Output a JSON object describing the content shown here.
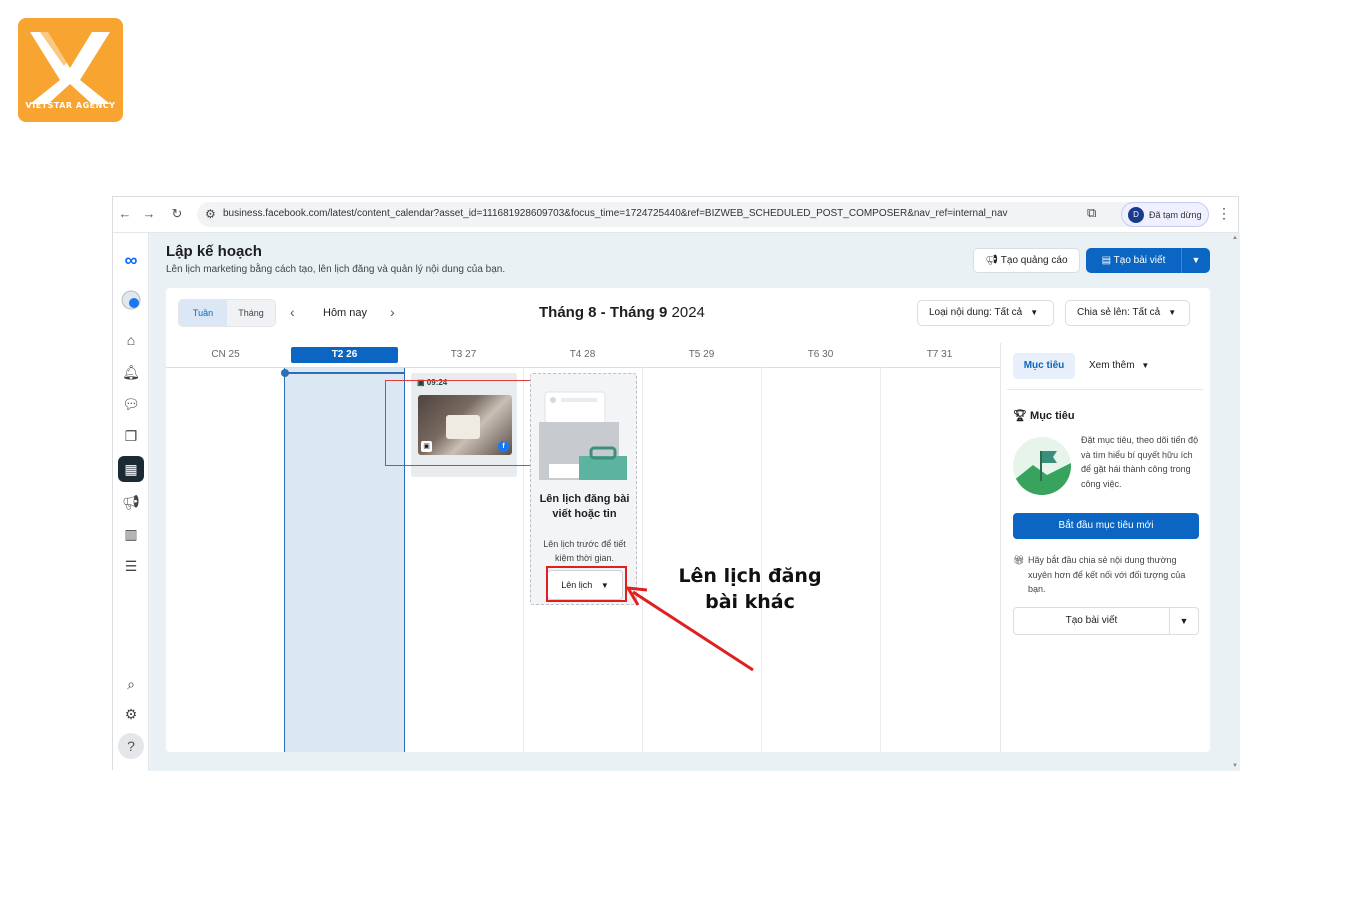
{
  "brand": {
    "logo_text": "VIETSTAR AGENCY",
    "accent": "#f7a530"
  },
  "browser": {
    "url": "business.facebook.com/latest/content_calendar?asset_id=111681928609703&focus_time=1724725440&ref=BIZWEB_SCHEDULED_POST_COMPOSER&nav_ref=internal_nav",
    "profile_initial": "D",
    "profile_label": "Đã tạm dừng"
  },
  "header": {
    "title": "Lập kế hoạch",
    "subtitle": "Lên lịch marketing bằng cách tạo, lên lịch đăng và quản lý nội dung của bạn.",
    "create_ad": "Tạo quảng cáo",
    "create_post": "Tạo bài viết"
  },
  "calendar": {
    "view_week": "Tuần",
    "view_month": "Tháng",
    "today": "Hôm nay",
    "range_bold": "Tháng 8 - Tháng 9",
    "range_year": "2024",
    "content_filter": "Loại nội dung: Tất cả",
    "share_filter": "Chia sẻ lên: Tất cả",
    "days": [
      "CN 25",
      "T2 26",
      "T3 27",
      "T4 28",
      "T5 29",
      "T6 30",
      "T7 31"
    ],
    "selected_day_index": 1,
    "post_time": "09:24",
    "empty_title": "Lên lịch đăng bài viết hoặc tin",
    "empty_sub": "Lên lịch trước để tiết kiệm thời gian.",
    "schedule_btn": "Lên lịch"
  },
  "right_panel": {
    "tab_goals": "Mục tiêu",
    "tab_more": "Xem thêm",
    "goal_heading": "Mục tiêu",
    "goal_text": "Đặt mục tiêu, theo dõi tiến độ và tìm hiểu bí quyết hữu ích để gặt hái thành công trong công việc.",
    "goal_button": "Bắt đầu mục tiêu mới",
    "share_text": "Hãy bắt đầu chia sẻ nội dung thường xuyên hơn để kết nối với đối tượng của bạn.",
    "create_post": "Tạo bài viết"
  },
  "annotation": {
    "line1": "Lên lịch đăng",
    "line2": "bài khác",
    "color": "#e02020"
  }
}
